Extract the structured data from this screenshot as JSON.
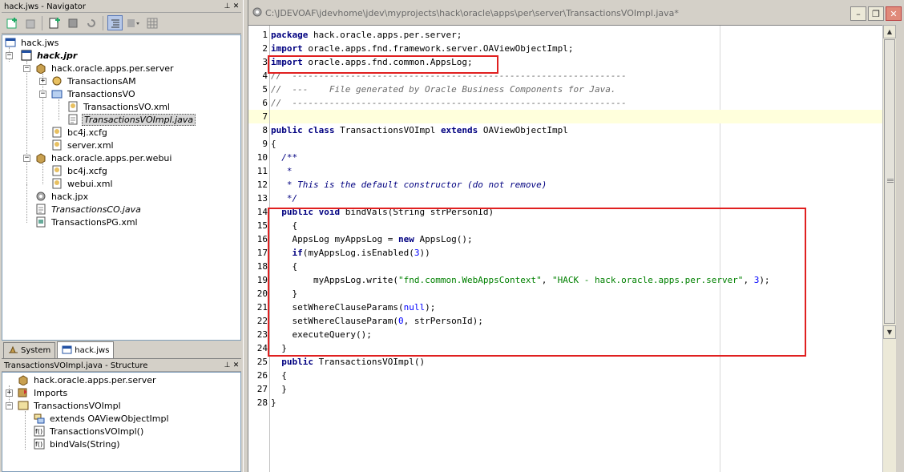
{
  "navigator": {
    "title": "hack.jws - Navigator",
    "tree": [
      {
        "label": "hack.jws"
      },
      {
        "label": "hack.jpr"
      },
      {
        "label": "hack.oracle.apps.per.server"
      },
      {
        "label": "TransactionsAM"
      },
      {
        "label": "TransactionsVO"
      },
      {
        "label": "TransactionsVO.xml"
      },
      {
        "label": "TransactionsVOImpl.java"
      },
      {
        "label": "bc4j.xcfg"
      },
      {
        "label": "server.xml"
      },
      {
        "label": "hack.oracle.apps.per.webui"
      },
      {
        "label": "bc4j.xcfg"
      },
      {
        "label": "webui.xml"
      },
      {
        "label": "hack.jpx"
      },
      {
        "label": "TransactionsCO.java"
      },
      {
        "label": "TransactionsPG.xml"
      }
    ],
    "tabs": [
      {
        "label": "System"
      },
      {
        "label": "hack.jws"
      }
    ]
  },
  "structure": {
    "title": "TransactionsVOImpl.java - Structure",
    "tree": [
      {
        "label": "hack.oracle.apps.per.server"
      },
      {
        "label": "Imports"
      },
      {
        "label": "TransactionsVOImpl"
      },
      {
        "label": "extends OAViewObjectImpl"
      },
      {
        "label": "TransactionsVOImpl()"
      },
      {
        "label": "bindVals(String)"
      }
    ]
  },
  "editor": {
    "path": "C:\\JDEVOAF\\jdevhome\\jdev\\myprojects\\hack\\oracle\\apps\\per\\server\\TransactionsVOImpl.java*",
    "window_buttons": {
      "minimize": "–",
      "restore": "❐",
      "close": "✕"
    },
    "lines": [
      {
        "no": "1",
        "parts": [
          [
            "k",
            "package"
          ],
          [
            "p",
            " hack.oracle.apps.per.server;"
          ]
        ]
      },
      {
        "no": "2",
        "parts": [
          [
            "k",
            "import"
          ],
          [
            "p",
            " oracle.apps.fnd.framework.server.OAViewObjectImpl;"
          ]
        ]
      },
      {
        "no": "3",
        "parts": [
          [
            "k",
            "import"
          ],
          [
            "p",
            " oracle.apps.fnd.common.AppsLog;"
          ]
        ]
      },
      {
        "no": "4",
        "parts": [
          [
            "c",
            "//  ---------------------------------------------------------------"
          ]
        ]
      },
      {
        "no": "5",
        "parts": [
          [
            "c",
            "//  ---    File generated by Oracle Business Components for Java."
          ]
        ]
      },
      {
        "no": "6",
        "parts": [
          [
            "c",
            "//  ---------------------------------------------------------------"
          ]
        ]
      },
      {
        "no": "7",
        "parts": []
      },
      {
        "no": "8",
        "parts": [
          [
            "k",
            "public class"
          ],
          [
            "p",
            " TransactionsVOImpl "
          ],
          [
            "k",
            "extends"
          ],
          [
            "p",
            " OAViewObjectImpl"
          ]
        ]
      },
      {
        "no": "9",
        "parts": [
          [
            "p",
            "{"
          ]
        ]
      },
      {
        "no": "10",
        "parts": [
          [
            "d",
            "  /**"
          ]
        ]
      },
      {
        "no": "11",
        "parts": [
          [
            "d",
            "   *"
          ]
        ]
      },
      {
        "no": "12",
        "parts": [
          [
            "d",
            "   * This is the default constructor (do not remove)"
          ]
        ]
      },
      {
        "no": "13",
        "parts": [
          [
            "d",
            "   */"
          ]
        ]
      },
      {
        "no": "14",
        "parts": [
          [
            "p",
            "  "
          ],
          [
            "k",
            "public void"
          ],
          [
            "p",
            " bindVals(String strPersonId)"
          ]
        ]
      },
      {
        "no": "15",
        "parts": [
          [
            "p",
            "    {"
          ]
        ]
      },
      {
        "no": "16",
        "parts": [
          [
            "p",
            "    AppsLog myAppsLog = "
          ],
          [
            "k",
            "new"
          ],
          [
            "p",
            " AppsLog();"
          ]
        ]
      },
      {
        "no": "17",
        "parts": [
          [
            "p",
            "    "
          ],
          [
            "k",
            "if"
          ],
          [
            "p",
            "(myAppsLog.isEnabled("
          ],
          [
            "n",
            "3"
          ],
          [
            "p",
            "))"
          ]
        ]
      },
      {
        "no": "18",
        "parts": [
          [
            "p",
            "    {"
          ]
        ]
      },
      {
        "no": "19",
        "parts": [
          [
            "p",
            "        myAppsLog.write("
          ],
          [
            "s",
            "\"fnd.common.WebAppsContext\""
          ],
          [
            "p",
            ", "
          ],
          [
            "s",
            "\"HACK - hack.oracle.apps.per.server\""
          ],
          [
            "p",
            ", "
          ],
          [
            "n",
            "3"
          ],
          [
            "p",
            ");"
          ]
        ]
      },
      {
        "no": "20",
        "parts": [
          [
            "p",
            "    }"
          ]
        ]
      },
      {
        "no": "21",
        "parts": [
          [
            "p",
            "    setWhereClauseParams("
          ],
          [
            "n",
            "null"
          ],
          [
            "p",
            ");"
          ]
        ]
      },
      {
        "no": "22",
        "parts": [
          [
            "p",
            "    setWhereClauseParam("
          ],
          [
            "n",
            "0"
          ],
          [
            "p",
            ", strPersonId);"
          ]
        ]
      },
      {
        "no": "23",
        "parts": [
          [
            "p",
            "    executeQuery();"
          ]
        ]
      },
      {
        "no": "24",
        "parts": [
          [
            "p",
            "  }"
          ]
        ]
      },
      {
        "no": "25",
        "parts": [
          [
            "p",
            "  "
          ],
          [
            "k",
            "public"
          ],
          [
            "p",
            " TransactionsVOImpl()"
          ]
        ]
      },
      {
        "no": "26",
        "parts": [
          [
            "p",
            "  {"
          ]
        ]
      },
      {
        "no": "27",
        "parts": [
          [
            "p",
            "  }"
          ]
        ]
      },
      {
        "no": "28",
        "parts": [
          [
            "p",
            "}"
          ]
        ]
      }
    ]
  },
  "colors": {
    "highlight_box": "#e02020",
    "keyword": "#000080",
    "string": "#008000",
    "number": "#0000ff",
    "current_line": "#ffffdc"
  }
}
